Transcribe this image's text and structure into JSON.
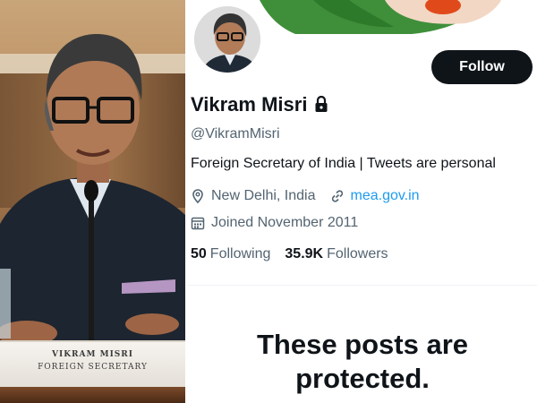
{
  "photo": {
    "nameplate_name": "VIKRAM MISRI",
    "nameplate_title": "FOREIGN SECRETARY"
  },
  "profile": {
    "display_name": "Vikram Misri",
    "handle": "@VikramMisri",
    "bio": "Foreign Secretary of India | Tweets are personal",
    "location": "New Delhi, India",
    "website": "mea.gov.in",
    "joined": "Joined November 2011",
    "following_count": "50",
    "following_label": "Following",
    "followers_count": "35.9K",
    "followers_label": "Followers",
    "follow_button": "Follow",
    "protected_message": "These posts are protected.",
    "icons": [
      "lock-icon",
      "location-icon",
      "link-icon",
      "calendar-icon"
    ]
  },
  "colors": {
    "text_primary": "#0f1419",
    "text_secondary": "#536471",
    "link": "#1d9bf0",
    "button_bg": "#0f1419",
    "button_text": "#ffffff"
  }
}
